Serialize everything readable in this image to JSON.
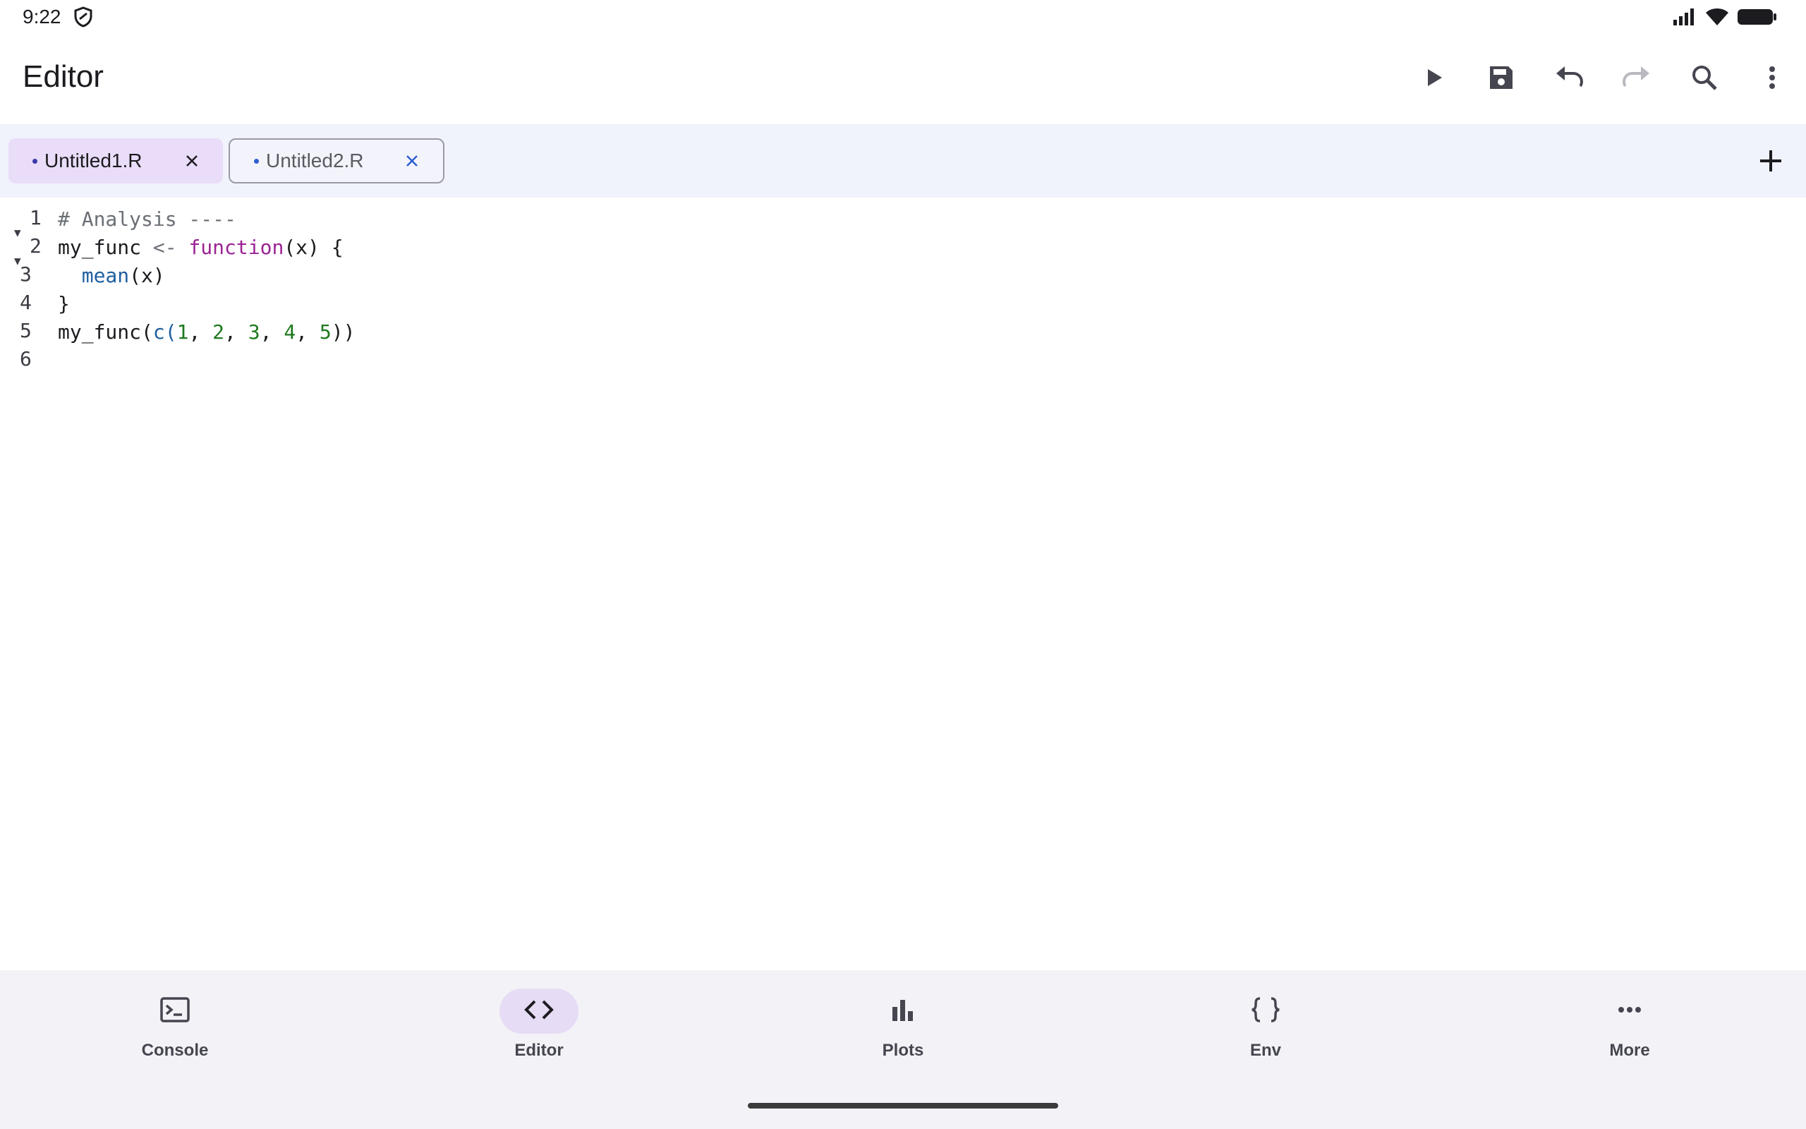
{
  "status_bar": {
    "time": "9:22"
  },
  "app_bar": {
    "title": "Editor",
    "actions": [
      "run",
      "save",
      "undo",
      "redo",
      "search",
      "more"
    ]
  },
  "tabs": [
    {
      "label": "Untitled1.R",
      "active": true
    },
    {
      "label": "Untitled2.R",
      "active": false
    }
  ],
  "editor": {
    "lines": [
      {
        "number": "1",
        "foldable": true
      },
      {
        "number": "2",
        "foldable": true
      },
      {
        "number": "3",
        "foldable": false
      },
      {
        "number": "4",
        "foldable": false
      },
      {
        "number": "5",
        "foldable": false
      },
      {
        "number": "6",
        "foldable": false
      }
    ],
    "tokens": {
      "l1_comment": "# Analysis ----",
      "l2_name": "my_func ",
      "l2_assign": "<-",
      "l2_kw": "function",
      "l2_rest": "(x) {",
      "l3_indent": "  ",
      "l3_fn": "mean",
      "l3_rest": "(x)",
      "l4": "}",
      "l5_name": "my_func(",
      "l5_c": "c(",
      "l5_n1": "1",
      "l5_n2": "2",
      "l5_n3": "3",
      "l5_n4": "4",
      "l5_n5": "5",
      "l5_sep": ", ",
      "l5_close": "))"
    }
  },
  "bottom_nav": [
    {
      "label": "Console",
      "icon": "terminal-icon",
      "selected": false
    },
    {
      "label": "Editor",
      "icon": "code-icon",
      "selected": true
    },
    {
      "label": "Plots",
      "icon": "bar-chart-icon",
      "selected": false
    },
    {
      "label": "Env",
      "icon": "braces-icon",
      "selected": false
    },
    {
      "label": "More",
      "icon": "more-horiz-icon",
      "selected": false
    }
  ],
  "colors": {
    "active_tab": "#e9ddf9",
    "tab_strip": "#f0f3fc",
    "nav_bg": "#f3f2f7",
    "keyword": "#9b2393",
    "function": "#1f5fa0",
    "number": "#1e7a1e"
  }
}
